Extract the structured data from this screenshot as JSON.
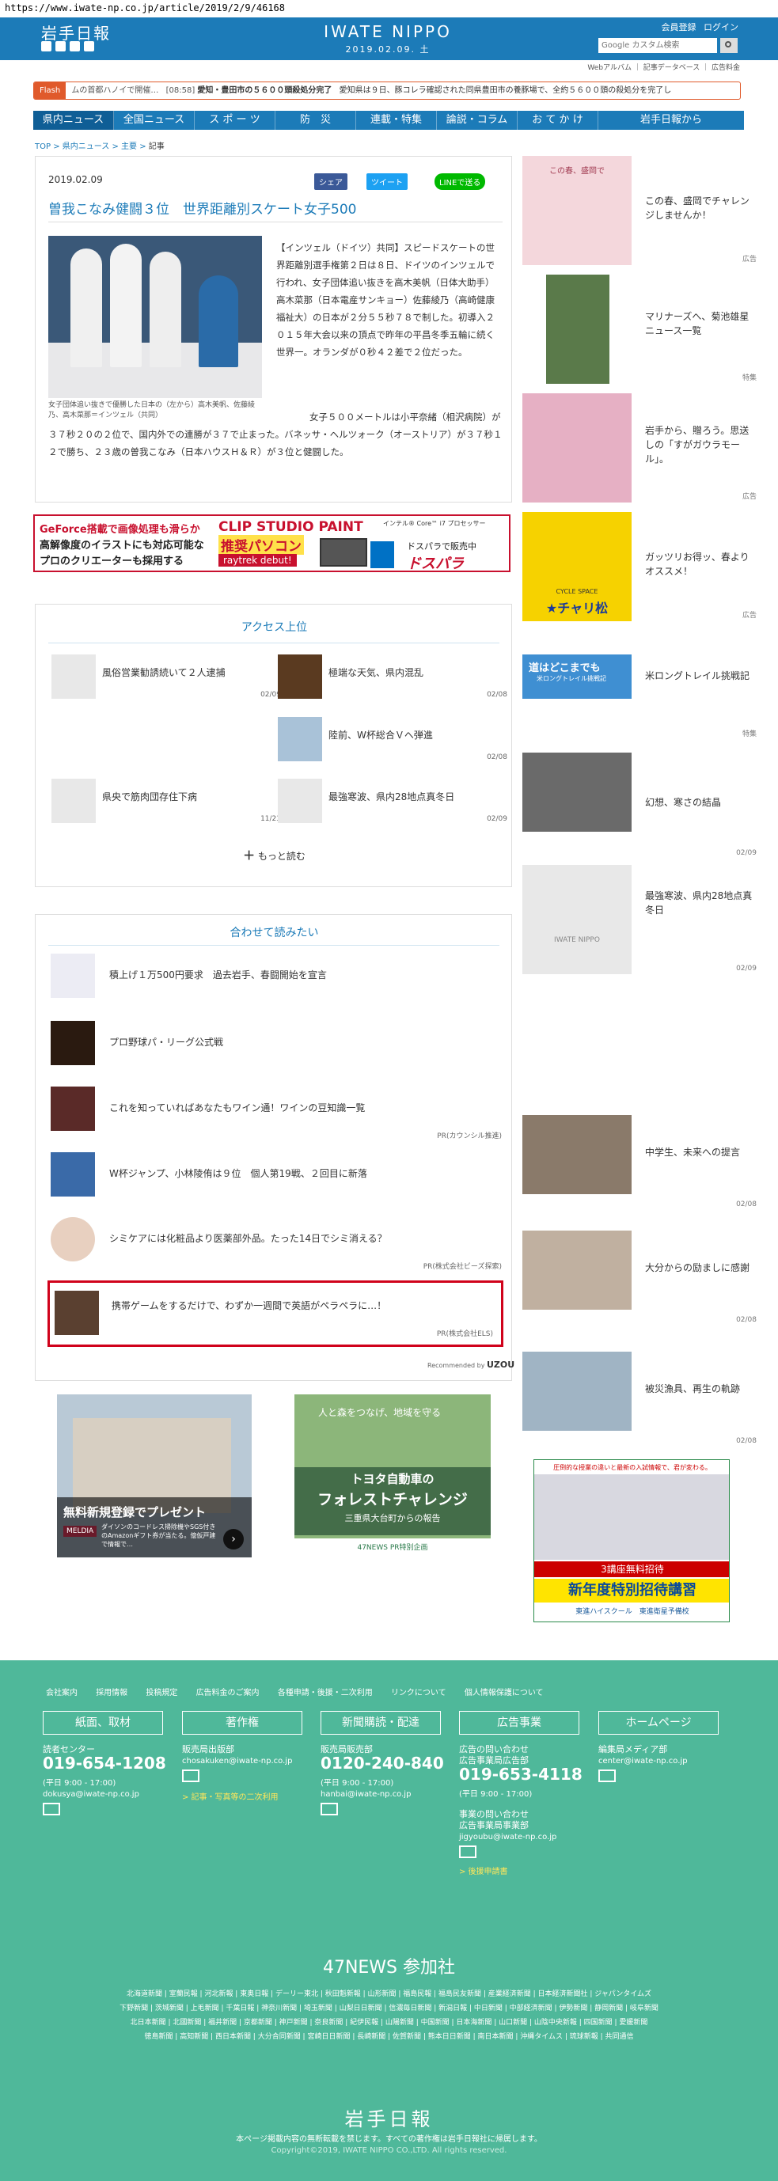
{
  "url": "https://www.iwate-np.co.jp/article/2019/2/9/46168",
  "header": {
    "logo_jp": "岩手日報",
    "logo_en": "IWATE NIPPO",
    "date": "2019.02.09. 土",
    "member": "会員登録",
    "login": "ログイン",
    "search_placeholder": "Google カスタム検索",
    "sub_links": [
      "Webアルバム",
      "記事データベース",
      "広告料金"
    ]
  },
  "flash": {
    "label": "Flash",
    "prefix": "ムの首都ハノイで開催…",
    "time": "[08:58]",
    "bold": "愛知・豊田市の５６００頭殺処分完了",
    "text": "愛知県は９日、豚コレラ確認された同県豊田市の養豚場で、全約５６００頭の殺処分を完了し"
  },
  "nav": [
    "県内ニュース",
    "全国ニュース",
    "ス ポ ー ツ",
    "防　災",
    "連載・特集",
    "論説・コラム",
    "お て か け",
    "岩手日報から"
  ],
  "breadcrumb": [
    "TOP",
    "県内ニュース",
    "主要",
    "記事"
  ],
  "article": {
    "date": "2019.02.09",
    "share_fb": "シェア",
    "share_tw": "ツイート",
    "share_line": "LINEで送る",
    "title": "曽我こなみ健闘３位　世界距離別スケート女子500",
    "caption": "女子団体追い抜きで優勝した日本の（左から）高木美帆、佐藤綾乃、高木菜那＝インツェル（共同）",
    "body1": "【インツェル（ドイツ）共同】スピードスケートの世界距離別選手権第２日は８日、ドイツのインツェルで行われ、女子団体追い抜きを高木美帆（日体大助手）高木菜那（日本電産サンキョー）佐藤綾乃（高崎健康福祉大）の日本が２分５５秒７８で制した。初導入２０１５年大会以来の頂点で昨年の平昌冬季五輪に続く世界一。オランダが０秒４２差で２位だった。",
    "body2": "女子５００メートルは小平奈緒（相沢病院）が３７秒２０の２位で、国内外での連勝が３７で止まった。バネッサ・ヘルツォーク（オーストリア）が３７秒１２で勝ち、２３歳の曽我こなみ（日本ハウスＨ＆Ｒ）が３位と健闘した。"
  },
  "banner": {
    "l1": "GeForce搭載で画像処理も滑らか",
    "l2": "高解像度のイラストにも対応可能な",
    "l3": "プロのクリエーターも採用する",
    "m1": "CLIP STUDIO PAINT",
    "m2": "推奨パソコン",
    "m3": "raytrek debut!",
    "r1": "インテル® Core™ i7 プロセッサー",
    "r2": "ドスパラで販売中",
    "r3": "ドスパラ"
  },
  "access": {
    "title": "アクセス上位",
    "items": [
      {
        "text": "風俗営業勧誘続いて２人逮捕",
        "date": "02/09"
      },
      {
        "text": "極端な天気、県内混乱",
        "date": "02/08"
      },
      {
        "text": "",
        "date": ""
      },
      {
        "text": "陸前、W杯総合Ｖへ弾進",
        "date": "02/08"
      },
      {
        "text": "県央で筋肉団存住下病",
        "date": "11/23"
      },
      {
        "text": "最強寒波、県内28地点真冬日",
        "date": "02/09"
      }
    ],
    "more": "もっと読む"
  },
  "related": {
    "title": "合わせて読みたい",
    "items": [
      {
        "text": "積上げ１万500円要求　過去岩手、春闘開始を宣言",
        "pr": ""
      },
      {
        "text": "プロ野球パ・リーグ公式戦",
        "pr": ""
      },
      {
        "text": "これを知っていればあなたもワイン通！ワインの豆知識一覧",
        "pr": "PR(カウンシル推進)"
      },
      {
        "text": "W杯ジャンプ、小林陵侑は９位　個人第19戦、２回目に新落",
        "pr": ""
      },
      {
        "text": "シミケアには化粧品より医薬部外品。たった14日でシミ消える？",
        "pr": "PR(株式会社ビーズ探索)"
      },
      {
        "text": "携帯ゲームをするだけで、わずか一週間で英語がペラペラに…！",
        "pr": "PR(株式会社ELS)"
      }
    ],
    "recommended": "Recommended by",
    "brand": "UZOU"
  },
  "ads": {
    "left_title": "無料新規登録でプレゼント",
    "left_sub": "ダイソンのコードレス掃除機やSGS付きのAmazonギフト券が当たる。億仮戸建で情報で…",
    "left_brand": "MELDIA",
    "right_top": "人と森をつなげ、地域を守る",
    "right_main1": "トヨタ自動車の",
    "right_main2": "フォレストチャレンジ",
    "right_sub": "三重県大台町からの報告",
    "right_foot": "47NEWS PR特別企画"
  },
  "sidebar": [
    {
      "text": "この春、盛岡でチャレンジしませんか！",
      "tag": "広告"
    },
    {
      "text": "マリナーズへ、菊池雄星ニュース一覧",
      "tag": "特集"
    },
    {
      "text": "岩手から、贈ろう。思送しの「すがガウラモール」。",
      "tag": "広告"
    },
    {
      "text": "ガッツリお得ッ、春よりオススメ！",
      "tag": "広告"
    },
    {
      "text": "米ロングトレイル挑戦記",
      "tag": "特集"
    },
    {
      "text": "幻想、寒さの結晶",
      "tag": "02/09"
    },
    {
      "text": "最強寒波、県内28地点真冬日",
      "tag": "02/09"
    },
    {
      "text": "中学生、未来への提言",
      "tag": "02/08"
    },
    {
      "text": "大分からの励ましに感謝",
      "tag": "02/08"
    },
    {
      "text": "被災漁具、再生の軌跡",
      "tag": "02/08"
    }
  ],
  "side_banner": {
    "t1": "圧倒的な授業の違いと最新の入試情報で、君が変わる。",
    "t2": "3講座無料招待",
    "t3": "新年度特別招待講習",
    "t4": "東進ハイスクール",
    "t5": "東進衛星予備校"
  },
  "side_labels": {
    "chari": "★チャリ松",
    "cycle": "CYCLE SPACE",
    "michi": "道はどこまでも",
    "michi_sub": "米ロングトレイル挑戦記",
    "iwate_logo": "IWATE NIPPO",
    "morioka": "この春、盛岡で"
  },
  "footer": {
    "links": [
      "会社案内",
      "採用情報",
      "投稿規定",
      "広告料金のご案内",
      "各種申請・後援・二次利用",
      "リンクについて",
      "個人情報保護について"
    ],
    "cols": [
      {
        "head": "紙面、取材",
        "l1": "読者センター",
        "tel": "019-654-1208",
        "hours": "(平日 9:00 - 17:00)",
        "mail": "dokusya@iwate-np.co.jp",
        "note": ""
      },
      {
        "head": "著作権",
        "l1": "販売局出版部",
        "tel": "",
        "hours": "",
        "mail": "chosakuken@iwate-np.co.jp",
        "note": "> 記事・写真等の二次利用"
      },
      {
        "head": "新聞購読・配達",
        "l1": "販売局販売部",
        "tel": "0120-240-840",
        "hours": "(平日 9:00 - 17:00)",
        "mail": "hanbai@iwate-np.co.jp",
        "note": ""
      },
      {
        "head": "広告事業",
        "l1": "広告の問い合わせ",
        "l2": "広告事業局広告部",
        "tel": "019-653-4118",
        "hours": "(平日 9:00 - 17:00)",
        "l3": "事業の問い合わせ",
        "l4": "広告事業局事業部",
        "mail": "jigyoubu@iwate-np.co.jp",
        "note": "> 後援申請書"
      },
      {
        "head": "ホームページ",
        "l1": "編集局メディア部",
        "tel": "",
        "hours": "",
        "mail": "center@iwate-np.co.jp",
        "note": ""
      }
    ],
    "n47_title": "47NEWS 参加社",
    "n47_rows": [
      "北海道新聞 | 室蘭民報 | 河北新報 | 東奥日報 | デーリー東北 | 秋田魁新報 | 山形新聞 | 福島民報 | 福島民友新聞 | 産業経済新聞 | 日本経済新聞社 | ジャパンタイムズ",
      "下野新聞 | 茨城新聞 | 上毛新聞 | 千葉日報 | 神奈川新聞 | 埼玉新聞 | 山梨日日新聞 | 信濃毎日新聞 | 新潟日報 | 中日新聞 | 中部経済新聞 | 伊勢新聞 | 静岡新聞 | 岐阜新聞",
      "北日本新聞 | 北國新聞 | 福井新聞 | 京都新聞 | 神戸新聞 | 奈良新聞 | 紀伊民報 | 山陽新聞 | 中国新聞 | 日本海新聞 | 山口新聞 | 山陰中央新報 | 四国新聞 | 愛媛新聞",
      "徳島新聞 | 高知新聞 | 西日本新聞 | 大分合同新聞 | 宮崎日日新聞 | 長崎新聞 | 佐賀新聞 | 熊本日日新聞 | 南日本新聞 | 沖縄タイムス | 琉球新報 | 共同通信"
    ],
    "logo": "岩手日報",
    "notice": "本ページ掲載内容の無断転載を禁じます。すべての著作権は岩手日報社に帰属します。",
    "copyright": "Copyright©2019, IWATE NIPPO CO.,LTD. All rights reserved."
  }
}
